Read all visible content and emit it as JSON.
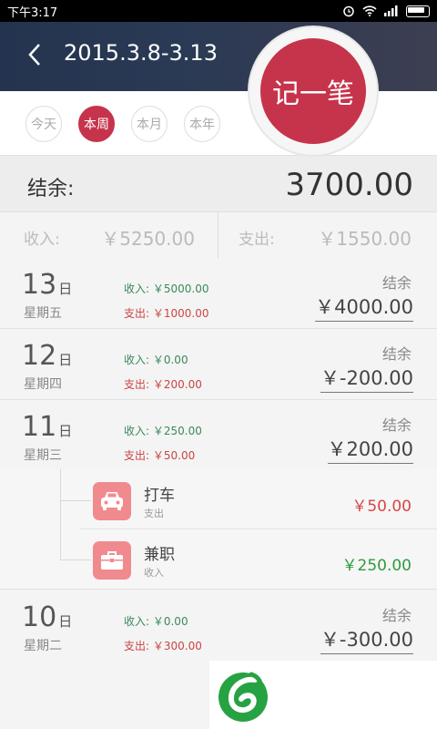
{
  "status": {
    "time": "下午3:17"
  },
  "header": {
    "title": "2015.3.8-3.13",
    "record_label": "记一笔"
  },
  "periods": [
    {
      "label": "今天",
      "active": false
    },
    {
      "label": "本周",
      "active": true
    },
    {
      "label": "本月",
      "active": false
    },
    {
      "label": "本年",
      "active": false
    }
  ],
  "summary": {
    "balance_label": "结余:",
    "balance_value": "3700.00",
    "income_label": "收入:",
    "income_value": "￥5250.00",
    "expense_label": "支出:",
    "expense_value": "￥1550.00"
  },
  "day_suffix": "日",
  "remaining_label": "结余",
  "days": [
    {
      "day": "13",
      "weekday": "星期五",
      "income": "收入: ￥5000.00",
      "expense": "支出: ￥1000.00",
      "balance": "￥4000.00"
    },
    {
      "day": "12",
      "weekday": "星期四",
      "income": "收入: ￥0.00",
      "expense": "支出: ￥200.00",
      "balance": "￥-200.00"
    },
    {
      "day": "11",
      "weekday": "星期三",
      "income": "收入: ￥250.00",
      "expense": "支出: ￥50.00",
      "balance": "￥200.00"
    },
    {
      "day": "10",
      "weekday": "星期二",
      "income": "收入: ￥0.00",
      "expense": "支出: ￥300.00",
      "balance": "￥-300.00"
    }
  ],
  "details": [
    {
      "icon": "car-icon",
      "name": "打车",
      "type": "支出",
      "amount": "￥50.00",
      "color": "#d94545"
    },
    {
      "icon": "briefcase-icon",
      "name": "兼职",
      "type": "收入",
      "amount": "￥250.00",
      "color": "#2e9a3e"
    }
  ],
  "colors": {
    "accent": "#c6344c",
    "income_green": "#3a8a5a",
    "expense_red": "#cc4444",
    "icon_bg": "#f18a8f",
    "logo_green": "#27a243"
  }
}
